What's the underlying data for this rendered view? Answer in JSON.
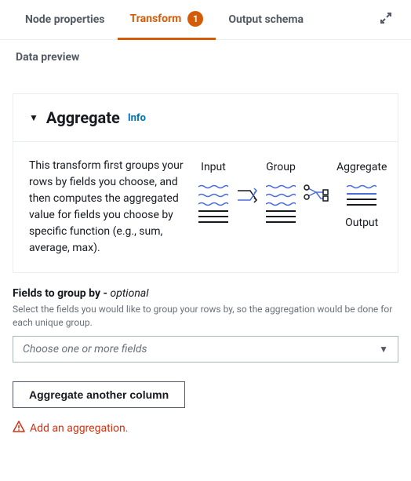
{
  "tabs": {
    "node_properties": "Node properties",
    "transform": "Transform",
    "transform_badge": "1",
    "output_schema": "Output schema",
    "data_preview": "Data preview"
  },
  "section": {
    "title": "Aggregate",
    "info": "Info",
    "description": "This transform first groups your rows by fields you choose, and then computes the aggregated value for fields you choose by specific function (e.g., sum, average, max)."
  },
  "diagram": {
    "input": "Input",
    "group": "Group",
    "aggregate": "Aggregate",
    "output": "Output"
  },
  "fields_group": {
    "label": "Fields to group by - ",
    "optional": "optional",
    "help": "Select the fields you would like to group your rows by, so the aggregation would be done for each unique group.",
    "placeholder": "Choose one or more fields"
  },
  "aggregate_btn": "Aggregate another column",
  "warning": "Add an aggregation."
}
